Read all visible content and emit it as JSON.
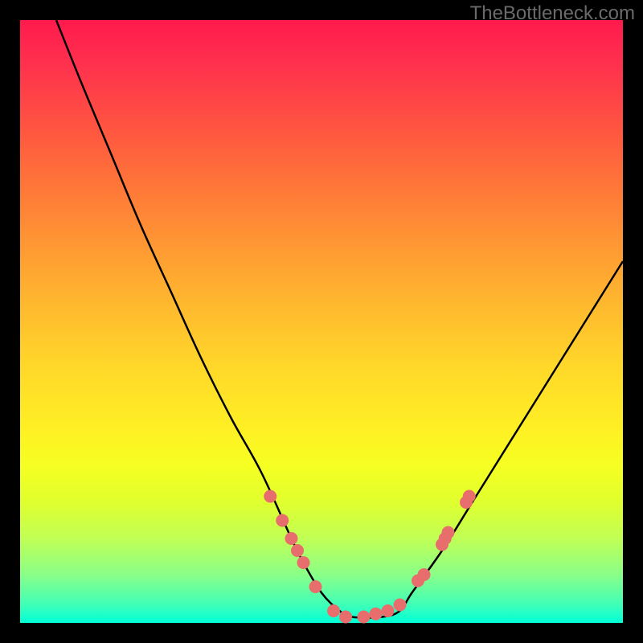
{
  "watermark": "TheBottleneck.com",
  "chart_data": {
    "type": "line",
    "title": "",
    "xlabel": "",
    "ylabel": "",
    "ylim": [
      0,
      100
    ],
    "xlim": [
      0,
      100
    ],
    "series": [
      {
        "name": "curve",
        "x": [
          6,
          10,
          15,
          20,
          25,
          30,
          35,
          40,
          45,
          47,
          50,
          53,
          55,
          60,
          63,
          65,
          70,
          75,
          80,
          85,
          90,
          95,
          100
        ],
        "y": [
          100,
          90,
          78,
          66,
          55,
          44,
          34,
          25,
          14,
          10,
          5,
          2,
          1,
          1,
          2,
          5,
          12,
          20,
          28,
          36,
          44,
          52,
          60
        ]
      }
    ],
    "markers": [
      {
        "x": 41.5,
        "y": 21
      },
      {
        "x": 43.5,
        "y": 17
      },
      {
        "x": 45,
        "y": 14
      },
      {
        "x": 46,
        "y": 12
      },
      {
        "x": 47,
        "y": 10
      },
      {
        "x": 49,
        "y": 6
      },
      {
        "x": 52,
        "y": 2
      },
      {
        "x": 54,
        "y": 1
      },
      {
        "x": 57,
        "y": 1
      },
      {
        "x": 59,
        "y": 1.5
      },
      {
        "x": 61,
        "y": 2
      },
      {
        "x": 63,
        "y": 3
      },
      {
        "x": 66,
        "y": 7
      },
      {
        "x": 67,
        "y": 8
      },
      {
        "x": 70,
        "y": 13
      },
      {
        "x": 70.5,
        "y": 14
      },
      {
        "x": 71,
        "y": 15
      },
      {
        "x": 74,
        "y": 20
      },
      {
        "x": 74.5,
        "y": 21
      }
    ],
    "colors": {
      "curve": "#000000",
      "marker": "#e86d6d"
    }
  }
}
